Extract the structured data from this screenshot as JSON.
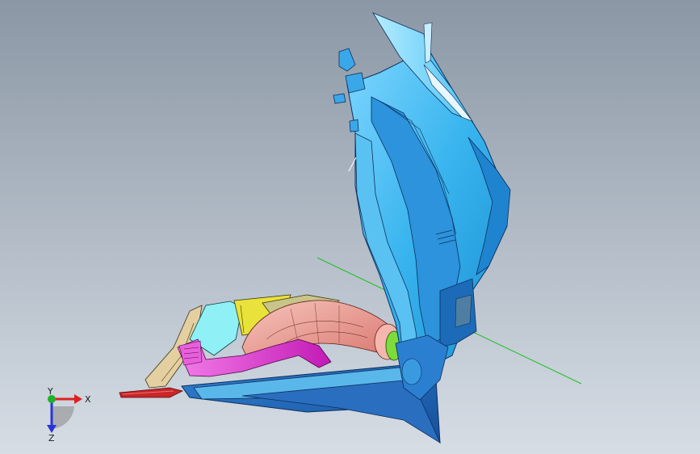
{
  "viewport": {
    "background_top": "#8b97a5",
    "background_bottom": "#d6dde5"
  },
  "model": {
    "parts": [
      {
        "name": "front-cowl",
        "color": "#3bb6ef"
      },
      {
        "name": "air-duct",
        "color": "#e8998f"
      },
      {
        "name": "hose",
        "color": "#e23fd6"
      },
      {
        "name": "bracket-yellow",
        "color": "#e8e23a"
      },
      {
        "name": "bracket-beige",
        "color": "#e3cfa0"
      },
      {
        "name": "bracket-green",
        "color": "#7ddc3a"
      },
      {
        "name": "rod-red",
        "color": "#c8262a"
      }
    ]
  },
  "triad": {
    "x_label": "X",
    "y_label": "Y",
    "z_label": "Z",
    "x_color": "#e02020",
    "y_color": "#21b02a",
    "z_color": "#2a33d8"
  }
}
